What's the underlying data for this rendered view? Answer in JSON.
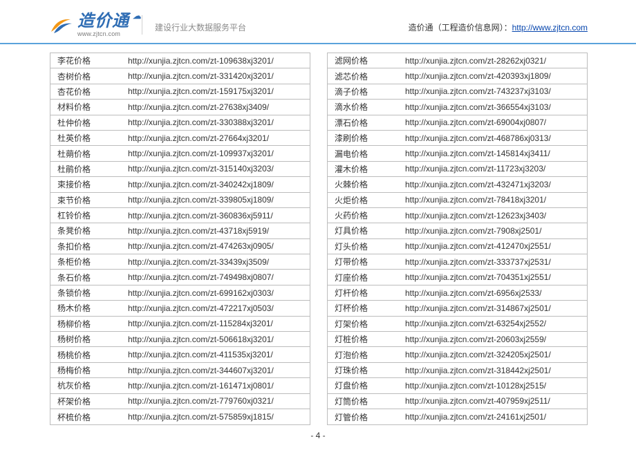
{
  "header": {
    "logo_cn": "造价通",
    "logo_url_text": "www.zjtcn.com",
    "platform_tag": "建设行业大数据服务平台",
    "right_prefix": "造价通（工程造价信息网）：",
    "right_link_text": "http://www.zjtcn.com"
  },
  "page_number": "- 4 -",
  "left_col": [
    {
      "name": "李花价格",
      "url": "http://xunjia.zjtcn.com/zt-109638xj3201/"
    },
    {
      "name": "杏树价格",
      "url": "http://xunjia.zjtcn.com/zt-331420xj3201/"
    },
    {
      "name": "杏花价格",
      "url": "http://xunjia.zjtcn.com/zt-159175xj3201/"
    },
    {
      "name": "材料价格",
      "url": "http://xunjia.zjtcn.com/zt-27638xj3409/"
    },
    {
      "name": "杜仲价格",
      "url": "http://xunjia.zjtcn.com/zt-330388xj3201/"
    },
    {
      "name": "杜英价格",
      "url": "http://xunjia.zjtcn.com/zt-27664xj3201/"
    },
    {
      "name": "杜蒴价格",
      "url": "http://xunjia.zjtcn.com/zt-109937xj3201/"
    },
    {
      "name": "杜鹃价格",
      "url": "http://xunjia.zjtcn.com/zt-315140xj3203/"
    },
    {
      "name": "束接价格",
      "url": "http://xunjia.zjtcn.com/zt-340242xj1809/"
    },
    {
      "name": "束节价格",
      "url": "http://xunjia.zjtcn.com/zt-339805xj1809/"
    },
    {
      "name": "杠铃价格",
      "url": "http://xunjia.zjtcn.com/zt-360836xj5911/"
    },
    {
      "name": "条凳价格",
      "url": "http://xunjia.zjtcn.com/zt-43718xj5919/"
    },
    {
      "name": "条扣价格",
      "url": "http://xunjia.zjtcn.com/zt-474263xj0905/"
    },
    {
      "name": "条柜价格",
      "url": "http://xunjia.zjtcn.com/zt-33439xj3509/"
    },
    {
      "name": "条石价格",
      "url": "http://xunjia.zjtcn.com/zt-749498xj0807/"
    },
    {
      "name": "条锁价格",
      "url": "http://xunjia.zjtcn.com/zt-699162xj0303/"
    },
    {
      "name": "杨木价格",
      "url": "http://xunjia.zjtcn.com/zt-472217xj0503/"
    },
    {
      "name": "杨柳价格",
      "url": "http://xunjia.zjtcn.com/zt-115284xj3201/"
    },
    {
      "name": "杨树价格",
      "url": "http://xunjia.zjtcn.com/zt-506618xj3201/"
    },
    {
      "name": "杨桃价格",
      "url": "http://xunjia.zjtcn.com/zt-411535xj3201/"
    },
    {
      "name": "杨梅价格",
      "url": "http://xunjia.zjtcn.com/zt-344607xj3201/"
    },
    {
      "name": "杭灰价格",
      "url": "http://xunjia.zjtcn.com/zt-161471xj0801/"
    },
    {
      "name": "杯架价格",
      "url": "http://xunjia.zjtcn.com/zt-779760xj0321/"
    },
    {
      "name": "杯梳价格",
      "url": "http://xunjia.zjtcn.com/zt-575859xj1815/"
    }
  ],
  "right_col": [
    {
      "name": "滤网价格",
      "url": "http://xunjia.zjtcn.com/zt-28262xj0321/"
    },
    {
      "name": "滤芯价格",
      "url": "http://xunjia.zjtcn.com/zt-420393xj1809/"
    },
    {
      "name": "滴子价格",
      "url": "http://xunjia.zjtcn.com/zt-743237xj3103/"
    },
    {
      "name": "滴水价格",
      "url": "http://xunjia.zjtcn.com/zt-366554xj3103/"
    },
    {
      "name": "漂石价格",
      "url": "http://xunjia.zjtcn.com/zt-69004xj0807/"
    },
    {
      "name": "漆刷价格",
      "url": "http://xunjia.zjtcn.com/zt-468786xj0313/"
    },
    {
      "name": "漏电价格",
      "url": "http://xunjia.zjtcn.com/zt-145814xj3411/"
    },
    {
      "name": "灌木价格",
      "url": "http://xunjia.zjtcn.com/zt-11723xj3203/"
    },
    {
      "name": "火棘价格",
      "url": "http://xunjia.zjtcn.com/zt-432471xj3203/"
    },
    {
      "name": "火炬价格",
      "url": "http://xunjia.zjtcn.com/zt-78418xj3201/"
    },
    {
      "name": "火药价格",
      "url": "http://xunjia.zjtcn.com/zt-12623xj3403/"
    },
    {
      "name": "灯具价格",
      "url": "http://xunjia.zjtcn.com/zt-7908xj2501/"
    },
    {
      "name": "灯头价格",
      "url": "http://xunjia.zjtcn.com/zt-412470xj2551/"
    },
    {
      "name": "灯带价格",
      "url": "http://xunjia.zjtcn.com/zt-333737xj2531/"
    },
    {
      "name": "灯座价格",
      "url": "http://xunjia.zjtcn.com/zt-704351xj2551/"
    },
    {
      "name": "灯杆价格",
      "url": "http://xunjia.zjtcn.com/zt-6956xj2533/"
    },
    {
      "name": "灯杯价格",
      "url": "http://xunjia.zjtcn.com/zt-314867xj2501/"
    },
    {
      "name": "灯架价格",
      "url": "http://xunjia.zjtcn.com/zt-63254xj2552/"
    },
    {
      "name": "灯桩价格",
      "url": "http://xunjia.zjtcn.com/zt-20603xj2559/"
    },
    {
      "name": "灯泡价格",
      "url": "http://xunjia.zjtcn.com/zt-324205xj2501/"
    },
    {
      "name": "灯珠价格",
      "url": "http://xunjia.zjtcn.com/zt-318442xj2501/"
    },
    {
      "name": "灯盘价格",
      "url": "http://xunjia.zjtcn.com/zt-10128xj2515/"
    },
    {
      "name": "灯筒价格",
      "url": "http://xunjia.zjtcn.com/zt-407959xj2511/"
    },
    {
      "name": "灯管价格",
      "url": "http://xunjia.zjtcn.com/zt-24161xj2501/"
    }
  ]
}
